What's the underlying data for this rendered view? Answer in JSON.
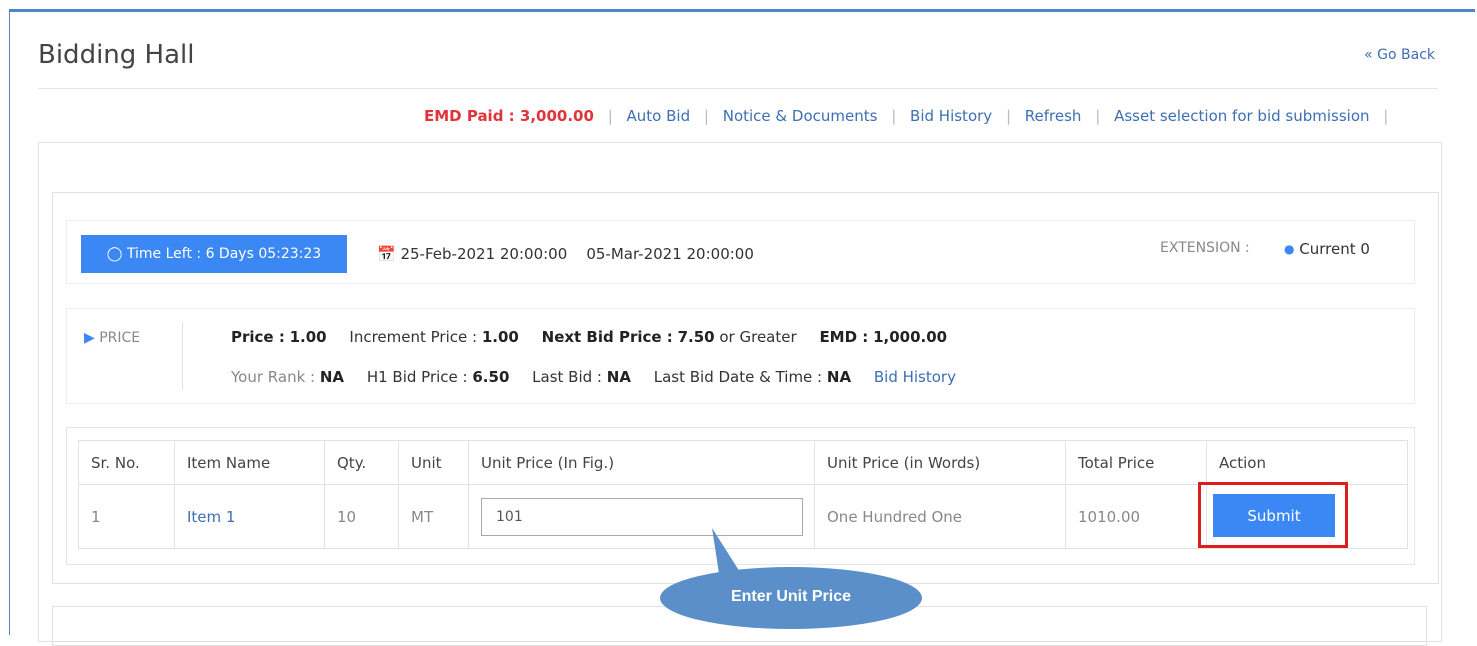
{
  "page": {
    "title": "Bidding Hall",
    "go_back": "« Go Back"
  },
  "toplinks": {
    "emd_paid": "EMD Paid : 3,000.00",
    "separator": "|",
    "auto_bid": "Auto Bid",
    "notice": "Notice & Documents",
    "bid_history": "Bid History",
    "refresh": "Refresh",
    "asset_selection": "Asset selection for bid submission"
  },
  "timer": {
    "time_left": "Time Left : 6 Days 05:23:23",
    "dates": "25-Feb-2021 20:00:00    05-Mar-2021 20:00:00",
    "extension_label": "EXTENSION :",
    "current": "Current 0"
  },
  "price": {
    "label": "PRICE",
    "price_label": "Price :",
    "price_value": "1.00",
    "increment_label": "Increment Price :",
    "increment_value": "1.00",
    "next_bid_label": "Next Bid Price :",
    "next_bid_value": "7.50",
    "next_bid_suffix": "or Greater",
    "emd_label": "EMD :",
    "emd_value": "1,000.00",
    "rank_label": "Your Rank :",
    "rank_value": "NA",
    "h1_label": "H1 Bid Price :",
    "h1_value": "6.50",
    "last_bid_label": "Last Bid :",
    "last_bid_value": "NA",
    "last_bid_time_label": "Last Bid Date & Time :",
    "last_bid_time_value": "NA",
    "bid_history_link": "Bid History"
  },
  "table": {
    "headers": [
      "Sr. No.",
      "Item Name",
      "Qty.",
      "Unit",
      "Unit Price (In Fig.)",
      "Unit Price (in Words)",
      "Total Price",
      "Action"
    ],
    "rows": [
      {
        "sr": "1",
        "item": "Item 1",
        "qty": "10",
        "unit": "MT",
        "unit_price_fig": "101",
        "unit_price_words": "One Hundred One",
        "total": "1010.00",
        "action": "Submit"
      }
    ]
  },
  "callout": {
    "text": "Enter Unit Price"
  },
  "colors": {
    "accent": "#3b88f5",
    "emd_red": "#e0333a",
    "link": "#3d6fb4",
    "highlight": "#e01c1c",
    "callout": "#5b8fc9"
  },
  "icons": [
    "clock-icon",
    "calendar-icon",
    "tag-icon",
    "bullet-dot-icon"
  ]
}
